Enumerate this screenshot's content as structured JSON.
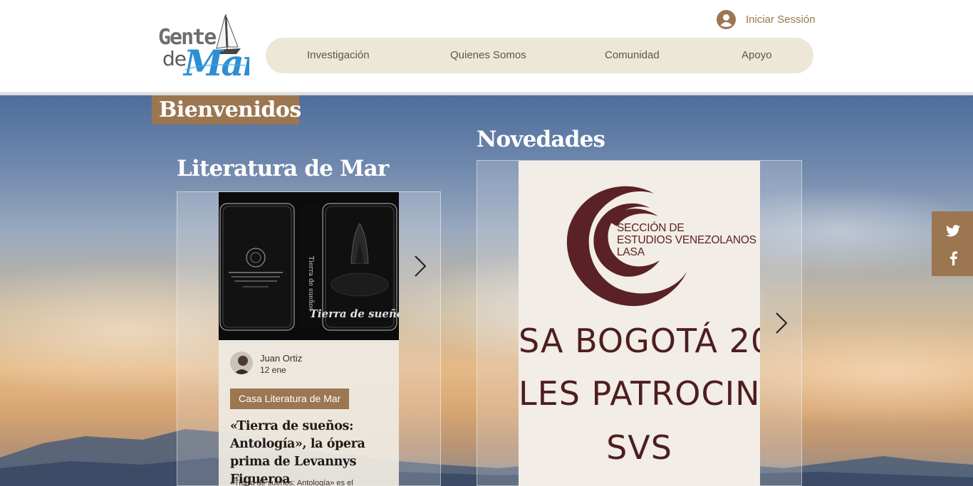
{
  "header": {
    "logo_alt": "Gente de Mar",
    "login_label": "Iniciar Sessión",
    "nav": [
      {
        "label": "Investigación"
      },
      {
        "label": "Quienes Somos"
      },
      {
        "label": "Comunidad"
      },
      {
        "label": "Apoyo"
      }
    ]
  },
  "hero": {
    "welcome": "Bienvenidos"
  },
  "literature": {
    "title": "Literatura de Mar",
    "post": {
      "author": "Juan Ortiz",
      "date": "12 ene",
      "category": "Casa Literatura de Mar",
      "title": "«Tierra de sueños: Antología», la ópera prima de Levannys Figueroa",
      "excerpt": "«Tierra de sueños: Antología» es el"
    },
    "book_cover_title": "Tierra de sueños"
  },
  "news": {
    "title": "Novedades",
    "org_lines": [
      "SECCIÓN DE",
      "ESTUDIOS VENEZOLANOS",
      "LASA"
    ],
    "big_lines": [
      "SA BOGOTÁ 20",
      "LES PATROCINA",
      "SVS"
    ]
  },
  "social": {
    "icons": [
      "twitter-icon",
      "facebook-icon"
    ]
  },
  "colors": {
    "accent": "#9b7650",
    "nav_bg": "#ede7d8",
    "news_text": "#4d1e22"
  }
}
